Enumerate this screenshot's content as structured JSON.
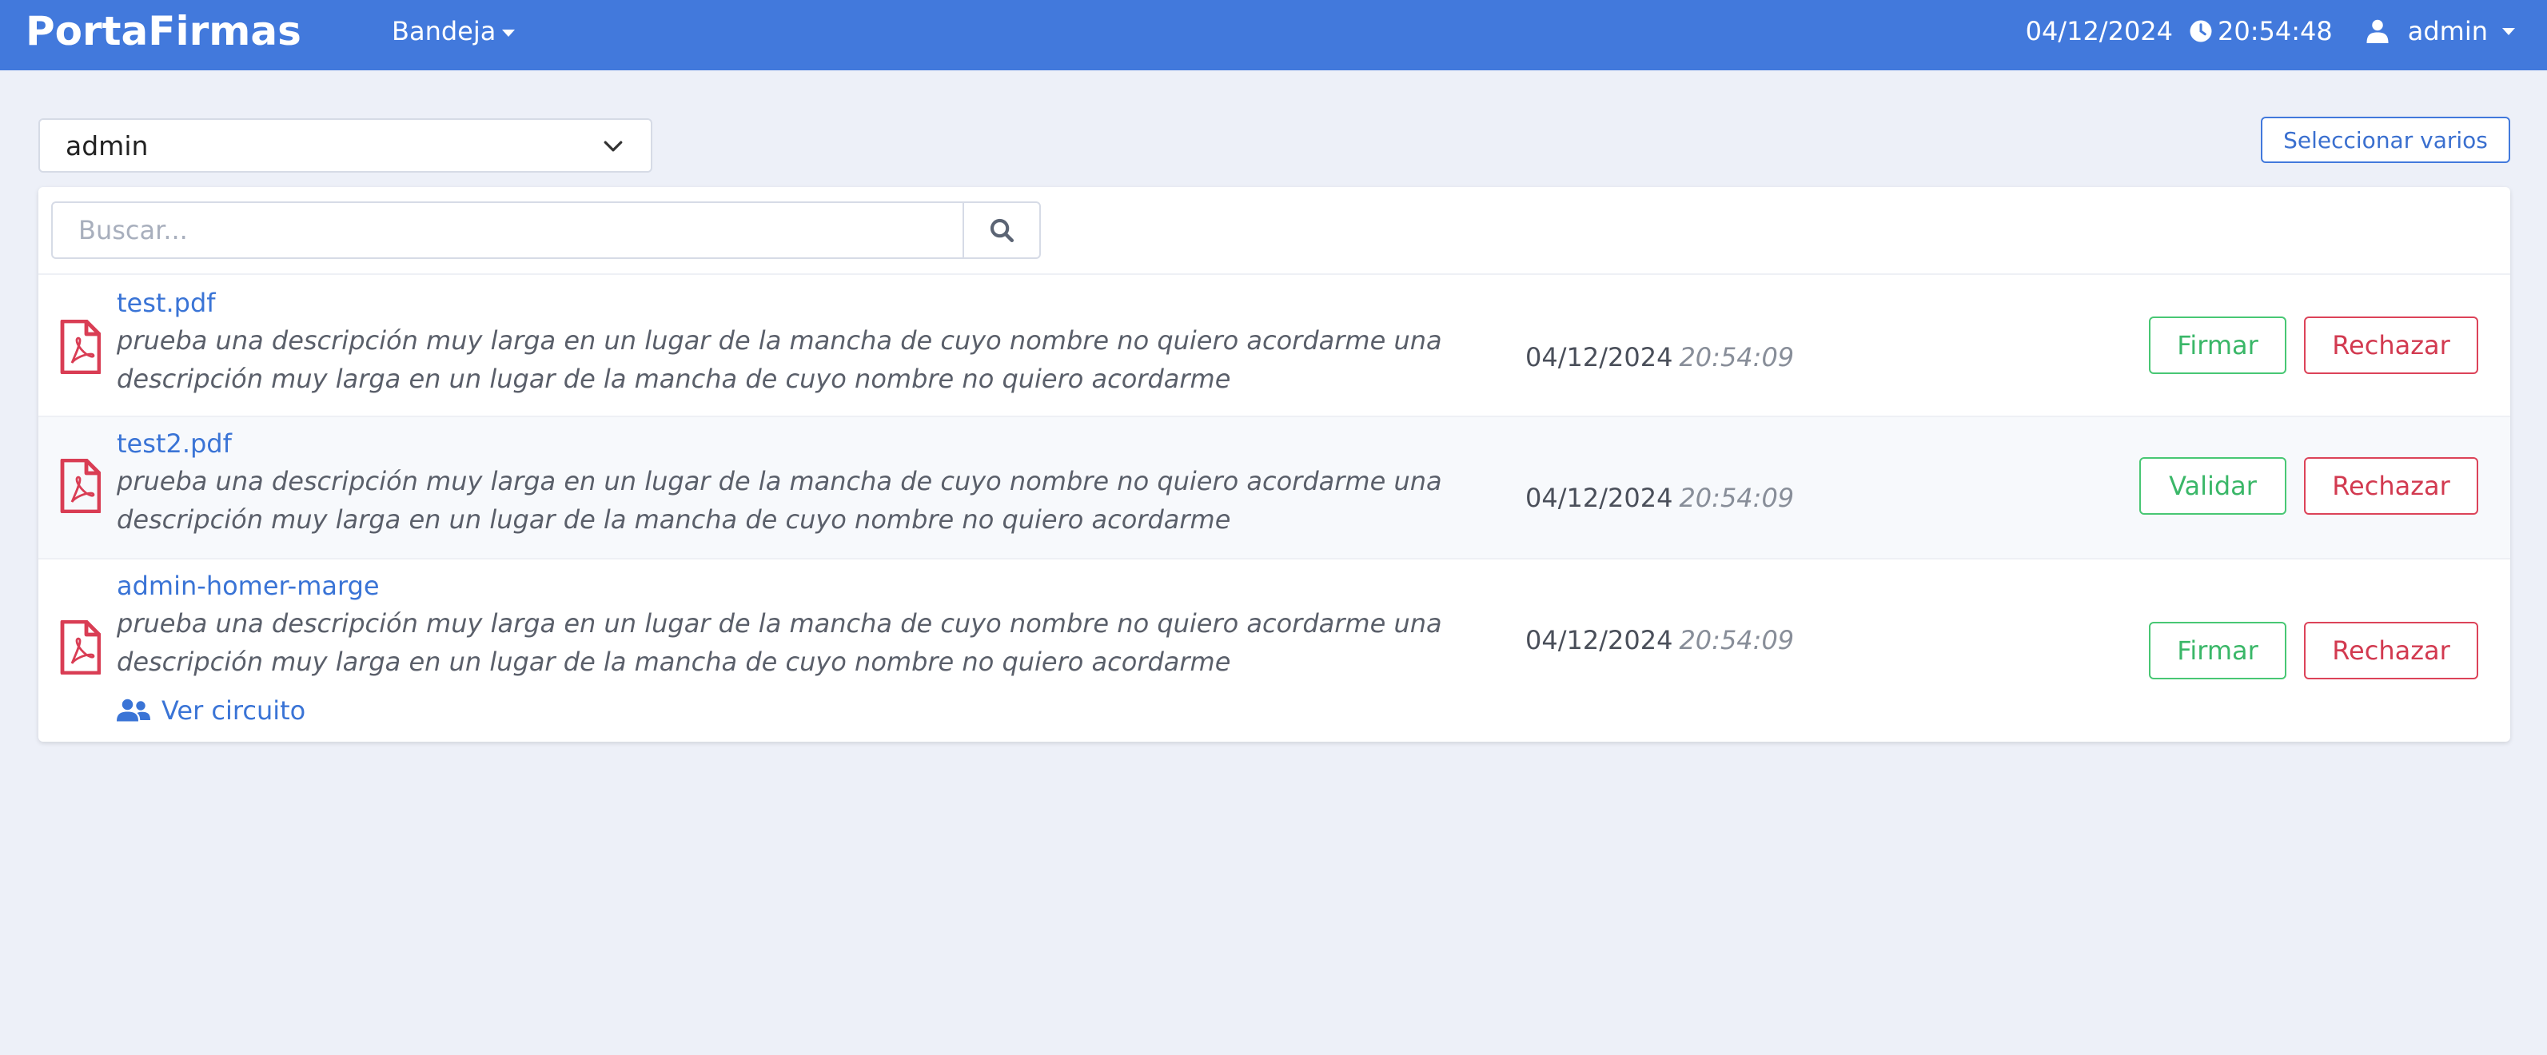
{
  "app": {
    "brand": "PortaFirmas"
  },
  "nav": {
    "menu_label": "Bandeja",
    "date": "04/12/2024",
    "time": "20:54:48",
    "user": "admin"
  },
  "toolbar": {
    "selected_user": "admin",
    "select_many_label": "Seleccionar varios"
  },
  "search": {
    "placeholder": "Buscar..."
  },
  "documents": [
    {
      "title": "test.pdf",
      "description": "prueba una descripción muy larga en un lugar de la mancha de cuyo nombre no quiero acordarme una descripción muy larga en un lugar de la mancha de cuyo nombre no quiero acordarme",
      "date": "04/12/2024",
      "time": "20:54:09",
      "primary_action": "Firmar",
      "secondary_action": "Rechazar"
    },
    {
      "title": "test2.pdf",
      "description": "prueba una descripción muy larga en un lugar de la mancha de cuyo nombre no quiero acordarme una descripción muy larga en un lugar de la mancha de cuyo nombre no quiero acordarme",
      "date": "04/12/2024",
      "time": "20:54:09",
      "primary_action": "Validar",
      "secondary_action": "Rechazar"
    },
    {
      "title": "admin-homer-marge",
      "description": "prueba una descripción muy larga en un lugar de la mancha de cuyo nombre no quiero acordarme una descripción muy larga en un lugar de la mancha de cuyo nombre no quiero acordarme",
      "date": "04/12/2024",
      "time": "20:54:09",
      "primary_action": "Firmar",
      "secondary_action": "Rechazar",
      "circuit_link": "Ver circuito"
    }
  ],
  "colors": {
    "navbar": "#4279dc",
    "background": "#edf0f8",
    "link": "#3a74d6",
    "success": "#48c774",
    "danger": "#dc4359"
  },
  "icons": [
    "clock-icon",
    "user-icon",
    "chevron-down-icon",
    "search-icon",
    "pdf-file-icon",
    "users-icon"
  ]
}
